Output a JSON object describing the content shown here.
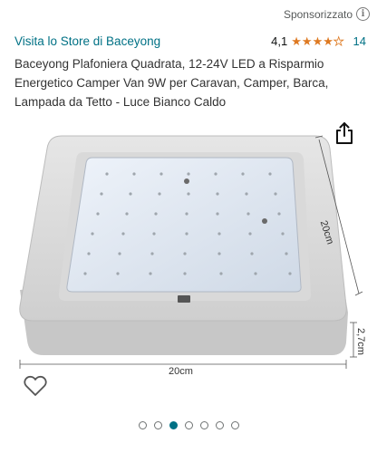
{
  "header": {
    "sponsored_label": "Sponsorizzato",
    "info_symbol": "i"
  },
  "store": {
    "link_label": "Visita lo Store di Baceyong"
  },
  "rating": {
    "value": "4,1",
    "stars_filled": 4,
    "stars_total": 5,
    "count": "14",
    "star_color": "#de7921"
  },
  "product": {
    "title": "Baceyong Plafoniera Quadrata, 12-24V LED a Risparmio Energetico Camper Van 9W per Caravan, Camper, Barca, Lampada da Tetto - Luce Bianco Caldo"
  },
  "image": {
    "dim_right": "20cm",
    "dim_height": "2,7cm",
    "dim_bottom": "20cm"
  },
  "carousel": {
    "total": 7,
    "active_index": 2,
    "accent_color": "#007185"
  },
  "icons": {
    "share": "share-icon",
    "wishlist": "heart-icon",
    "info": "info-icon"
  }
}
